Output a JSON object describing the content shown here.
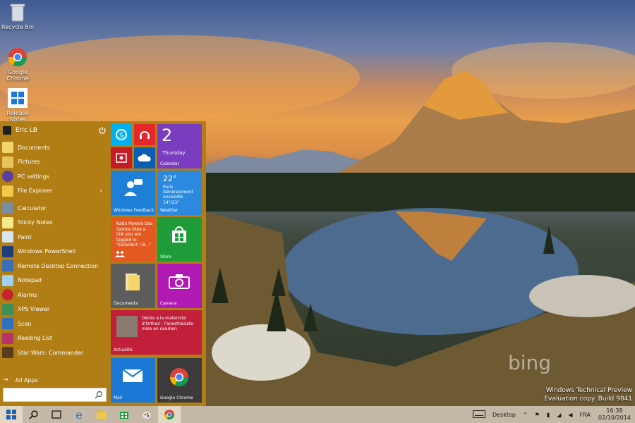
{
  "desktop": {
    "icons": [
      {
        "label": "Recycle Bin",
        "icon": "recycle-bin-icon"
      },
      {
        "label": "Google Chrome",
        "icon": "chrome-icon"
      },
      {
        "label": "Release Notes",
        "icon": "windows-logo-icon"
      }
    ],
    "watermark": {
      "brand": "bing",
      "line1": "Windows Technical Preview",
      "line2": "Evaluation copy. Build 9841"
    }
  },
  "start_menu": {
    "user": "Eric LB",
    "places": [
      {
        "label": "Documents",
        "icon": "documents-icon"
      },
      {
        "label": "Pictures",
        "icon": "pictures-icon"
      },
      {
        "label": "PC settings",
        "icon": "gear-icon"
      },
      {
        "label": "File Explorer",
        "icon": "folder-icon"
      }
    ],
    "apps": [
      {
        "label": "Calculator",
        "icon": "calculator-icon"
      },
      {
        "label": "Sticky Notes",
        "icon": "sticky-notes-icon"
      },
      {
        "label": "Paint",
        "icon": "paint-icon"
      },
      {
        "label": "Windows PowerShell",
        "icon": "powershell-icon"
      },
      {
        "label": "Remote Desktop Connection",
        "icon": "remote-desktop-icon"
      },
      {
        "label": "Notepad",
        "icon": "notepad-icon"
      },
      {
        "label": "Alarms",
        "icon": "alarm-icon"
      },
      {
        "label": "XPS Viewer",
        "icon": "xps-viewer-icon"
      },
      {
        "label": "Scan",
        "icon": "scan-icon"
      },
      {
        "label": "Reading List",
        "icon": "reading-list-icon"
      },
      {
        "label": "Star Wars: Commander",
        "icon": "star-wars-icon"
      }
    ],
    "all_apps": "All Apps",
    "tiles": {
      "calendar_day": "2",
      "calendar_weekday": "Thursday",
      "calendar_label": "Calendar",
      "feedback_label": "Windows Feedback",
      "weather_temp": "22°",
      "weather_city": "Paris",
      "weather_desc": "Généralement ensoleillé",
      "weather_range": "14°/23°",
      "weather_label": "Weather",
      "people_text": "Katia Pereira Dos Santos likes a link you are tagged in: \"Excellent ! B...\"",
      "store_label": "Store",
      "documents_label": "Documents",
      "camera_label": "Camera",
      "news_text": "Décès à la maternité d'Orthez : l'anesthésiste mise en examen",
      "news_label": "Actualité",
      "mail_label": "Mail",
      "chrome_label": "Google Chrome"
    },
    "colors": {
      "menu_bg": "#b07e14",
      "skype": "#00aff0",
      "music": "#e3272a",
      "video": "#c61b27",
      "onedrive": "#0a5eb3",
      "calendar": "#7a3dbf",
      "feedback": "#1d7fd6",
      "weather": "#2b8ae0",
      "people": "#e25a22",
      "store": "#1f9b3a",
      "documents": "#5c5c5c",
      "camera": "#b01ab3",
      "news": "#c21f3a",
      "mail": "#1b78d4",
      "chrome_tile": "#3b3b3b"
    }
  },
  "taskbar": {
    "buttons": [
      "windows-start-icon",
      "search-icon",
      "task-view-icon",
      "ie-icon",
      "file-explorer-icon",
      "store-icon",
      "paint-icon",
      "chrome-icon"
    ],
    "desktop_label": "Desktop",
    "language": "FRA",
    "time": "16:38",
    "date": "02/10/2014"
  }
}
